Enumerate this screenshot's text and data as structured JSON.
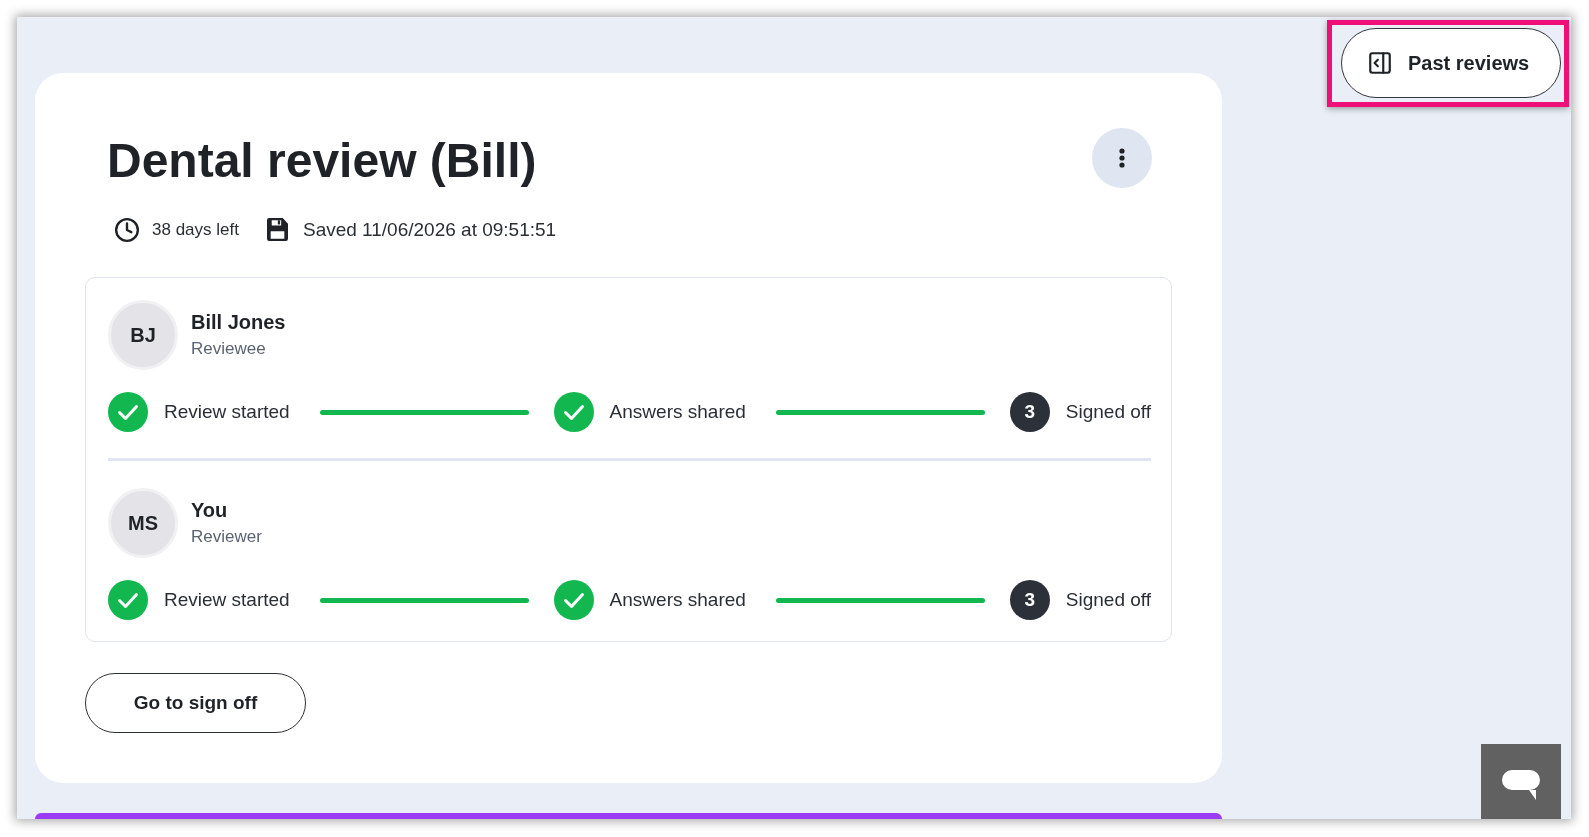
{
  "past_reviews_button": {
    "label": "Past reviews",
    "highlighted": true
  },
  "review": {
    "title": "Dental review (Bill)",
    "days_left": "38 days left",
    "saved": "Saved 11/06/2026 at 09:51:51",
    "participants": [
      {
        "initials": "BJ",
        "name": "Bill Jones",
        "role": "Reviewee",
        "steps": [
          {
            "label": "Review started",
            "done": true
          },
          {
            "label": "Answers shared",
            "done": true
          },
          {
            "label": "Signed off",
            "done": false,
            "number": "3"
          }
        ]
      },
      {
        "initials": "MS",
        "name": "You",
        "role": "Reviewer",
        "steps": [
          {
            "label": "Review started",
            "done": true
          },
          {
            "label": "Answers shared",
            "done": true
          },
          {
            "label": "Signed off",
            "done": false,
            "number": "3"
          }
        ]
      }
    ],
    "sign_off_button": {
      "label": "Go to sign off"
    }
  }
}
